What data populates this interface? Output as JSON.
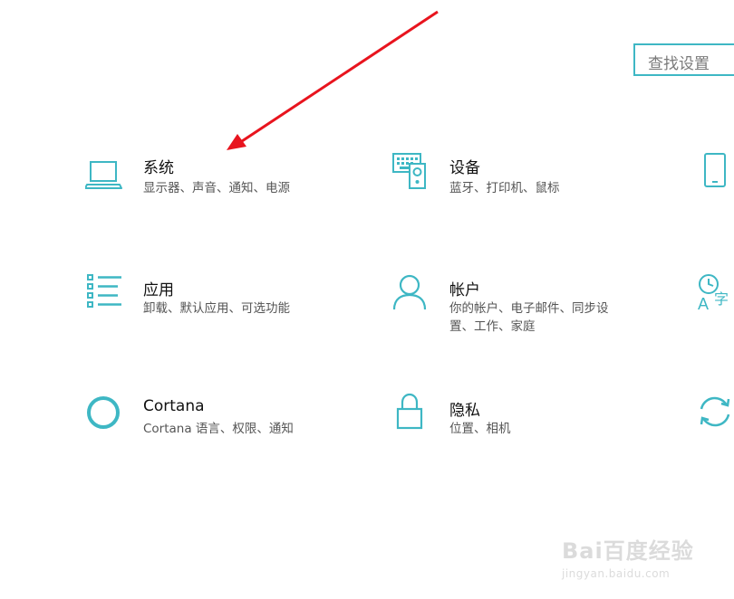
{
  "search": {
    "placeholder": "查找设置"
  },
  "tiles": [
    {
      "title": "系统",
      "desc": [
        "显示器、声音、通知、电源"
      ],
      "icon": "laptop-icon"
    },
    {
      "title": "设备",
      "desc": [
        "蓝牙、打印机、鼠标"
      ],
      "icon": "keyboard-speaker-icon"
    },
    {
      "title": "应用",
      "desc": [
        "卸载、默认应用、可选功能"
      ],
      "icon": "list-icon"
    },
    {
      "title": "帐户",
      "desc": [
        "你的帐户、电子邮件、同步设",
        "置、工作、家庭"
      ],
      "icon": "person-icon"
    },
    {
      "title": "Cortana",
      "desc": [
        "Cortana 语言、权限、通知"
      ],
      "icon": "circle-icon"
    },
    {
      "title": "隐私",
      "desc": [
        "位置、相机"
      ],
      "icon": "lock-icon"
    }
  ],
  "partial_icons": [
    "phone-icon",
    "time-language-icon",
    "sync-icon"
  ],
  "annotation": {
    "arrow_color": "#e8141e"
  },
  "watermark": {
    "top": "Bai百度经验",
    "bottom": "jingyan.baidu.com"
  },
  "colors": {
    "accent": "#3eb7c4",
    "arrow": "#e8141e"
  }
}
